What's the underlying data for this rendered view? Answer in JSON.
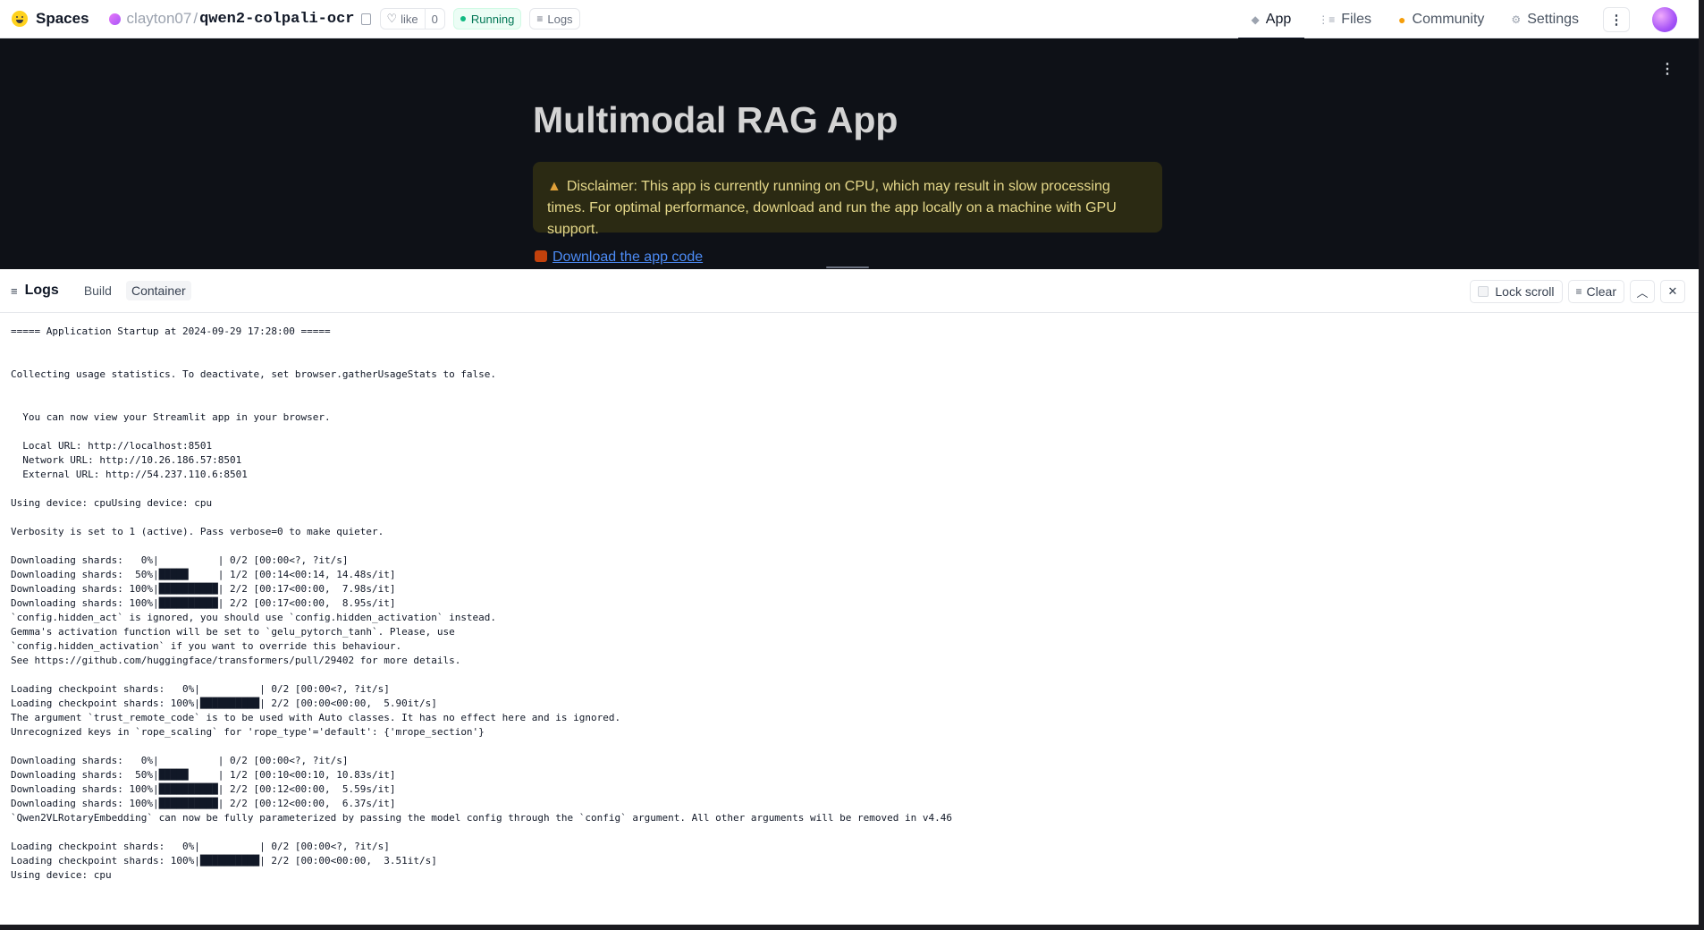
{
  "header": {
    "brand": "Spaces",
    "owner": "clayton07",
    "separator": "/",
    "repo_name": "qwen2-colpali-ocr",
    "like_label": "like",
    "like_count": "0",
    "status": "Running",
    "logs_label": "Logs",
    "nav": [
      {
        "label": "App",
        "icon": "cube-icon"
      },
      {
        "label": "Files",
        "icon": "files-icon"
      },
      {
        "label": "Community",
        "icon": "community-icon"
      },
      {
        "label": "Settings",
        "icon": "gear-icon"
      }
    ],
    "kebab": "⋮"
  },
  "app": {
    "title": "Multimodal RAG App",
    "disclaimer": "Disclaimer: This app is currently running on CPU, which may result in slow processing times. For optimal performance, download and run the app locally on a machine with GPU support.",
    "download_link": "Download the app code",
    "menu_glyph": "⋮"
  },
  "logs": {
    "title": "Logs",
    "tabs": [
      "Build",
      "Container"
    ],
    "active_tab": "Container",
    "lock_scroll": "Lock scroll",
    "clear": "Clear",
    "lines": [
      "===== Application Startup at 2024-09-29 17:28:00 =====",
      "",
      "",
      "Collecting usage statistics. To deactivate, set browser.gatherUsageStats to false.",
      "",
      "",
      "  You can now view your Streamlit app in your browser.",
      "",
      "  Local URL: http://localhost:8501",
      "  Network URL: http://10.26.186.57:8501",
      "  External URL: http://54.237.110.6:8501",
      "",
      "Using device: cpuUsing device: cpu",
      "",
      "Verbosity is set to 1 (active). Pass verbose=0 to make quieter.",
      "",
      "Downloading shards:   0%|          | 0/2 [00:00<?, ?it/s]",
      "Downloading shards:  50%|█████     | 1/2 [00:14<00:14, 14.48s/it]",
      "Downloading shards: 100%|██████████| 2/2 [00:17<00:00,  7.98s/it]",
      "Downloading shards: 100%|██████████| 2/2 [00:17<00:00,  8.95s/it]",
      "`config.hidden_act` is ignored, you should use `config.hidden_activation` instead.",
      "Gemma's activation function will be set to `gelu_pytorch_tanh`. Please, use",
      "`config.hidden_activation` if you want to override this behaviour.",
      "See https://github.com/huggingface/transformers/pull/29402 for more details.",
      "",
      "Loading checkpoint shards:   0%|          | 0/2 [00:00<?, ?it/s]",
      "Loading checkpoint shards: 100%|██████████| 2/2 [00:00<00:00,  5.90it/s]",
      "The argument `trust_remote_code` is to be used with Auto classes. It has no effect here and is ignored.",
      "Unrecognized keys in `rope_scaling` for 'rope_type'='default': {'mrope_section'}",
      "",
      "Downloading shards:   0%|          | 0/2 [00:00<?, ?it/s]",
      "Downloading shards:  50%|█████     | 1/2 [00:10<00:10, 10.83s/it]",
      "Downloading shards: 100%|██████████| 2/2 [00:12<00:00,  5.59s/it]",
      "Downloading shards: 100%|██████████| 2/2 [00:12<00:00,  6.37s/it]",
      "`Qwen2VLRotaryEmbedding` can now be fully parameterized by passing the model config through the `config` argument. All other arguments will be removed in v4.46",
      "",
      "Loading checkpoint shards:   0%|          | 0/2 [00:00<?, ?it/s]",
      "Loading checkpoint shards: 100%|██████████| 2/2 [00:00<00:00,  3.51it/s]",
      "Using device: cpu"
    ]
  }
}
